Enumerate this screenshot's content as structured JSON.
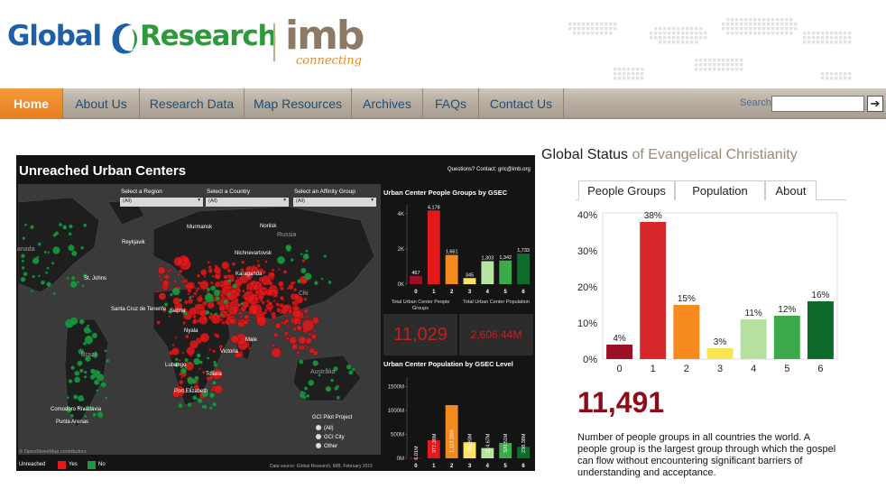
{
  "header": {
    "logo_global": "Global",
    "logo_research": "Research",
    "logo_imb": "imb",
    "logo_tagline": "connecting"
  },
  "nav": {
    "items": [
      {
        "label": "Home",
        "active": true
      },
      {
        "label": "About Us"
      },
      {
        "label": "Research Data"
      },
      {
        "label": "Map Resources"
      },
      {
        "label": "Archives"
      },
      {
        "label": "FAQs"
      },
      {
        "label": "Contact Us"
      }
    ],
    "search_label": "Search",
    "search_value": "",
    "search_button": "arrow-right-icon"
  },
  "dashboard": {
    "title": "Unreached Urban Centers",
    "questions": "Questions? Contact: gric@imb.org",
    "filters": [
      {
        "label": "Select a Region",
        "value": "(All)"
      },
      {
        "label": "Select a Country",
        "value": "(All)"
      },
      {
        "label": "Select an Affinity Group",
        "value": "(All)"
      }
    ],
    "map_labels": {
      "murmansk": "Murmansk",
      "norilsk": "Norilsk",
      "russia": "Russia",
      "reykjavik": "Reykjavik",
      "nichnevartovsk": "Nichnevartovsk",
      "karaganda": "Karaganda",
      "st_johns": "St. Johns",
      "canada": "anada",
      "santa_cruz": "Santa Cruz de Tenerife",
      "sebha": "Sebha",
      "chi": "Chi",
      "nyala": "Nyala",
      "male": "Male",
      "victoria": "Victoria",
      "lubango": "Lubango",
      "toliara": "Toliara",
      "brazil": "Brazil",
      "australia": "Australia",
      "port_elizabeth": "Port Elizabeth",
      "comodoro": "Comodoro Rivadavia",
      "punta_arenas": "Punta Arenas"
    },
    "osm_credit": "© OpenStreetMap contributors",
    "pilot": {
      "title": "GCI Pilot Project",
      "options": [
        "(All)",
        "GCI City",
        "Other"
      ]
    },
    "legend": {
      "title": "Unreached",
      "items": [
        {
          "label": "Yes",
          "color": "#e31a1c"
        },
        {
          "label": "No",
          "color": "#1a9a3c"
        }
      ]
    },
    "data_source": "Data source: Global Research, IMB, February 2015",
    "totals": {
      "people_groups_label": "Total Urban Center People Groups",
      "people_groups_value": "11,029",
      "population_label": "Total Urban Center Population",
      "population_value": "2,606.44M"
    }
  },
  "chart_data": [
    {
      "type": "bar",
      "title": "Urban Center People Groups by GSEC",
      "categories": [
        "0",
        "1",
        "2",
        "3",
        "4",
        "5",
        "6"
      ],
      "values": [
        467,
        4178,
        1661,
        345,
        1303,
        1342,
        1733
      ],
      "value_labels": [
        "467",
        "4,178",
        "1,661",
        "345",
        "1,303",
        "1,342",
        "1,733"
      ],
      "y_ticks": [
        "0K",
        "2K",
        "4K"
      ],
      "ylim": [
        0,
        4500
      ],
      "colors": [
        "#9b1026",
        "#e31a1c",
        "#f48a1e",
        "#ffe466",
        "#b7e4a0",
        "#3daa4a",
        "#0d6b2c"
      ]
    },
    {
      "type": "bar",
      "title": "Urban Center Population by GSEC Level",
      "categories": [
        "0",
        "1",
        "2",
        "3",
        "4",
        "5",
        "6"
      ],
      "values": [
        6.01,
        377.39,
        1113.26,
        335.93,
        214.67,
        320.51,
        238.38
      ],
      "value_labels": [
        "6.01M",
        "377.39M",
        "1,113.26M",
        "335.93M",
        "214.67M",
        "320.51M",
        "238.38M"
      ],
      "y_ticks": [
        "0M",
        "500M",
        "1000M",
        "1500M"
      ],
      "ylim": [
        0,
        1700
      ],
      "colors": [
        "#9b1026",
        "#e31a1c",
        "#f48a1e",
        "#ffe466",
        "#b7e4a0",
        "#3daa4a",
        "#0d6b2c"
      ]
    },
    {
      "type": "bar",
      "title": "",
      "categories": [
        "0",
        "1",
        "2",
        "3",
        "4",
        "5",
        "6"
      ],
      "values": [
        4,
        38,
        15,
        3,
        11,
        12,
        16
      ],
      "value_labels": [
        "4%",
        "38%",
        "15%",
        "3%",
        "11%",
        "12%",
        "16%"
      ],
      "y_ticks": [
        "0%",
        "10%",
        "20%",
        "30%",
        "40%"
      ],
      "ylim": [
        0,
        40
      ],
      "colors": [
        "#9b1026",
        "#d7262c",
        "#f6891f",
        "#fbe54f",
        "#b5e0a0",
        "#3caa4a",
        "#0d6a2b"
      ]
    }
  ],
  "global_status": {
    "title_strong": "Global Status",
    "title_light": " of Evangelical Christianity",
    "tabs": [
      {
        "label": "People Groups",
        "active": true
      },
      {
        "label": "Population"
      },
      {
        "label": "About"
      }
    ],
    "big_number": "11,491",
    "description": "Number of people groups in all countries the world. A people group is the largest group through which the gospel can flow without encountering significant barriers of understanding and acceptance."
  }
}
